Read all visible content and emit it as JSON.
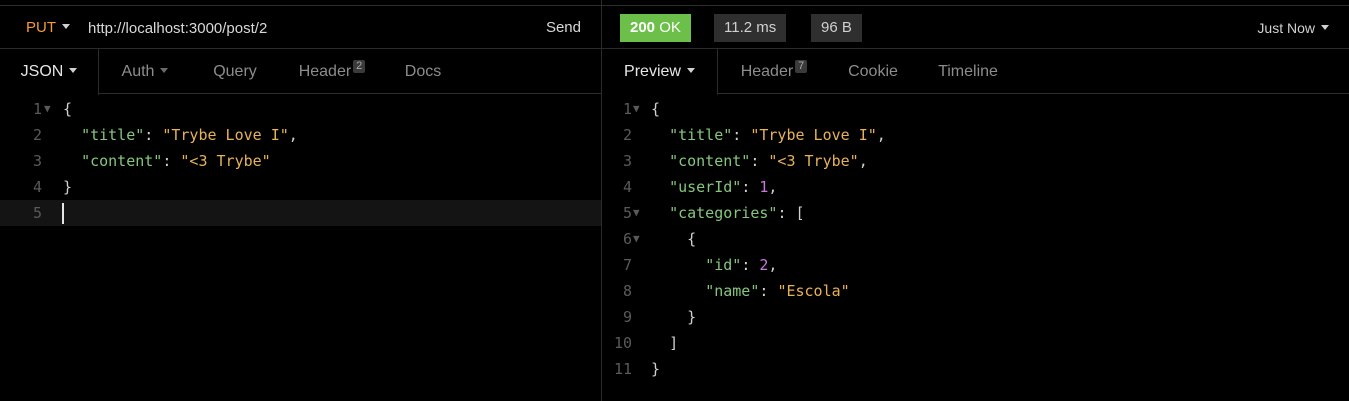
{
  "request": {
    "method": "PUT",
    "url": "http://localhost:3000/post/2",
    "send_label": "Send",
    "tabs": [
      {
        "label": "JSON",
        "badge": ""
      },
      {
        "label": "Auth",
        "badge": ""
      },
      {
        "label": "Query",
        "badge": ""
      },
      {
        "label": "Header",
        "badge": "2"
      },
      {
        "label": "Docs",
        "badge": ""
      }
    ],
    "line_numbers": [
      "1",
      "2",
      "3",
      "4",
      "5"
    ],
    "lines": {
      "l1_open": "{",
      "l2_key": "\"title\"",
      "l2_colon": ": ",
      "l2_val": "\"Trybe Love I\"",
      "l2_comma": ",",
      "l3_key": "\"content\"",
      "l3_colon": ": ",
      "l3_val": "\"<3 Trybe\"",
      "l4_close": "}"
    }
  },
  "response": {
    "status_code": "200",
    "status_text": "OK",
    "time": "11.2 ms",
    "size": "96 B",
    "history_label": "Just Now",
    "tabs": [
      {
        "label": "Preview",
        "badge": ""
      },
      {
        "label": "Header",
        "badge": "7"
      },
      {
        "label": "Cookie",
        "badge": ""
      },
      {
        "label": "Timeline",
        "badge": ""
      }
    ],
    "line_numbers": [
      "1",
      "2",
      "3",
      "4",
      "5",
      "6",
      "7",
      "8",
      "9",
      "10",
      "11"
    ],
    "lines": {
      "l1_open": "{",
      "l2_key": "\"title\"",
      "l2_val": "\"Trybe Love I\"",
      "l3_key": "\"content\"",
      "l3_val": "\"<3 Trybe\"",
      "l4_key": "\"userId\"",
      "l4_val": "1",
      "l5_key": "\"categories\"",
      "l5_open": "[",
      "l6_open": "{",
      "l7_key": "\"id\"",
      "l7_val": "2",
      "l8_key": "\"name\"",
      "l8_val": "\"Escola\"",
      "l9_close": "}",
      "l10_close": "]",
      "l11_close": "}"
    },
    "colon": ": ",
    "comma": ","
  },
  "colors": {
    "method": "#f39b3a",
    "status_ok": "#6cc04a",
    "json_key": "#84c77b",
    "json_string": "#e7b259",
    "json_number": "#c678dd"
  },
  "icons": [
    "caret-down-icon",
    "fold-arrow-icon"
  ]
}
